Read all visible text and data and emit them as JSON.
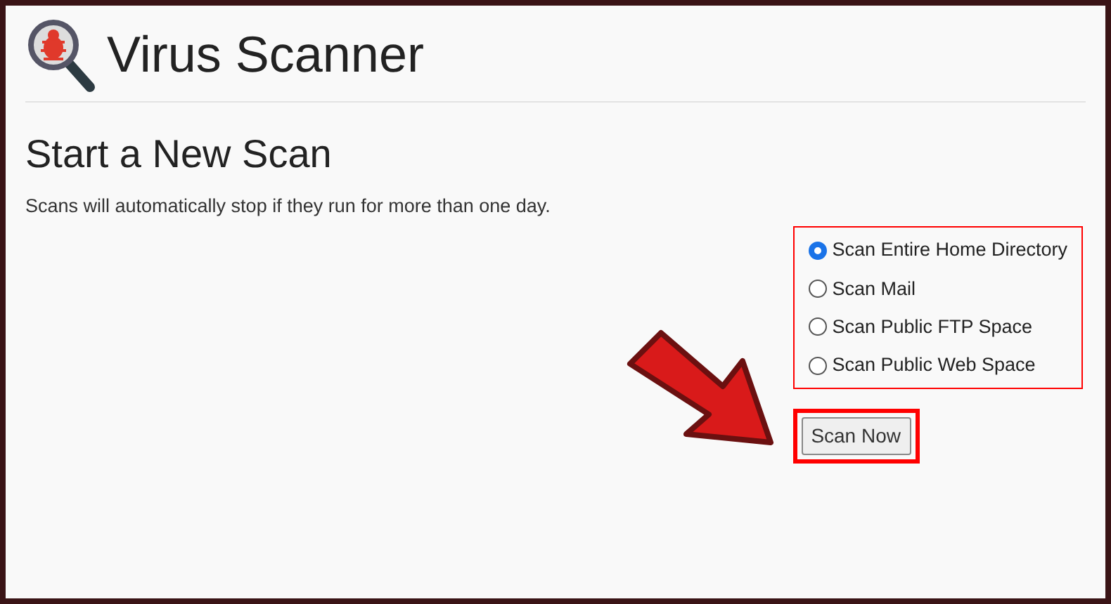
{
  "title": "Virus Scanner",
  "section": {
    "heading": "Start a New Scan",
    "note": "Scans will automatically stop if they run for more than one day."
  },
  "options": [
    {
      "label": "Scan Entire Home Directory",
      "selected": true
    },
    {
      "label": "Scan Mail",
      "selected": false
    },
    {
      "label": "Scan Public FTP Space",
      "selected": false
    },
    {
      "label": "Scan Public Web Space",
      "selected": false
    }
  ],
  "button": "Scan Now"
}
